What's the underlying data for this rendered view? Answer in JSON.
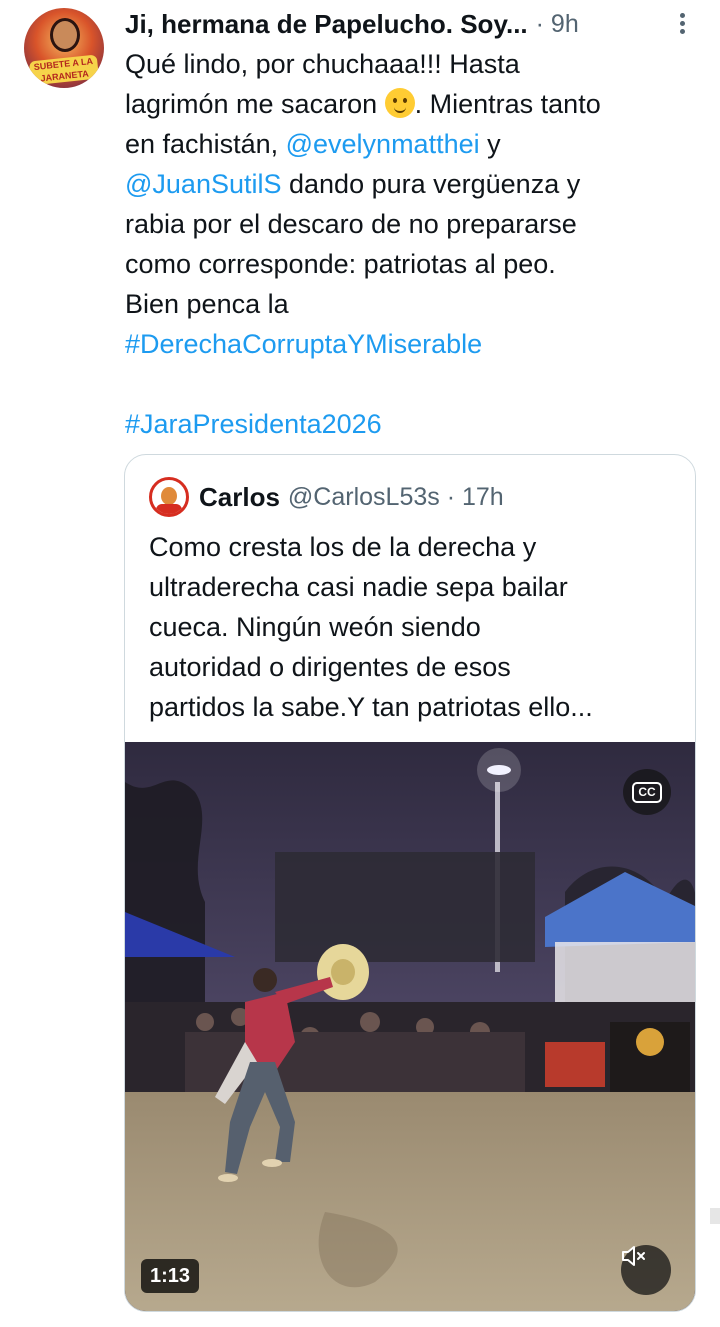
{
  "tweet": {
    "author_name": "Ji, hermana de Papelucho. Soy...",
    "time": "· 9h",
    "avatar_text": "SUBETE A LA JARANETA",
    "lines": [
      [
        "Qué lindo, por chuchaaa!!! Hasta"
      ],
      [
        "lagrimón me sacaron ",
        "{emoji}",
        ".  Mientras tanto"
      ],
      [
        "en fachistán, ",
        "@evelynmatthei",
        " y"
      ],
      [
        "@JuanSutilS",
        " dando pura vergüenza y"
      ],
      [
        "rabia por el descaro de no prepararse"
      ],
      [
        "como corresponde: patriotas al peo."
      ],
      [
        "Bien penca la"
      ],
      [
        "#DerechaCorruptaYMiserable"
      ],
      [
        ""
      ],
      [
        "#JaraPresidenta2026"
      ]
    ],
    "text": {
      "l1": "Qué lindo, por chuchaaa!!! Hasta",
      "l2a": "lagrimón me sacaron ",
      "l2b": ".  Mientras tanto",
      "l3a": "en fachistán, ",
      "mention1": "@evelynmatthei",
      "l3b": " y",
      "mention2": "@JuanSutilS",
      "l4b": " dando pura vergüenza y",
      "l5": "rabia por el descaro de no prepararse",
      "l6": "como corresponde: patriotas al peo.",
      "l7": "Bien penca la",
      "hashtag1": "#DerechaCorruptaYMiserable",
      "hashtag2": "#JaraPresidenta2026"
    },
    "emoji_name": "smiling-face-with-tear-icon"
  },
  "quote": {
    "name": "Carlos",
    "meta": "@CarlosL53s · 17h",
    "lines": {
      "l1": "Como cresta los de la derecha y",
      "l2": "ultraderecha casi nadie sepa bailar",
      "l3": "cueca. Ningún weón siendo",
      "l4": "autoridad o dirigentes de esos",
      "l5": "partidos la sabe.Y tan patriotas ello..."
    },
    "video": {
      "cc_label": "CC",
      "duration": "1:13",
      "mute_icon": "speaker-muted-icon"
    }
  },
  "colors": {
    "link": "#1d9bf0",
    "text": "#0f1419",
    "secondary": "#536471",
    "border": "#cfd9de"
  }
}
